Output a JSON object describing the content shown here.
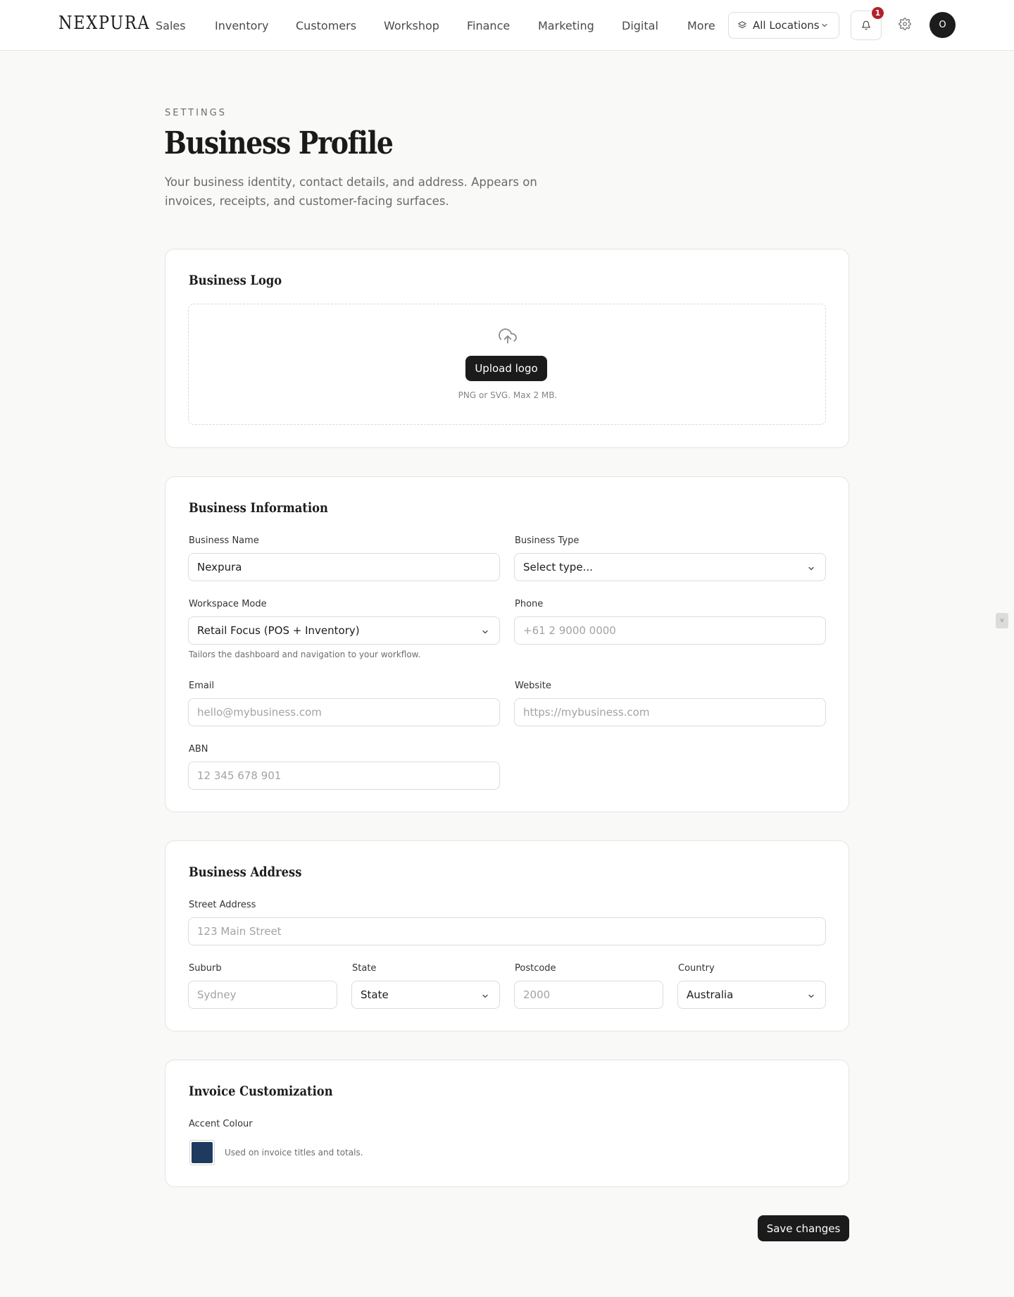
{
  "app": {
    "brand": "NEXPURA"
  },
  "nav": {
    "items": [
      "Sales",
      "Inventory",
      "Customers",
      "Workshop",
      "Finance",
      "Marketing",
      "Digital",
      "More"
    ],
    "location_selector": "All Locations",
    "notifications_count": "1",
    "avatar_initial": "O"
  },
  "header": {
    "eyebrow": "SETTINGS",
    "title": "Business Profile",
    "description": "Your business identity, contact details, and address. Appears on invoices, receipts, and customer-facing surfaces."
  },
  "logo_card": {
    "title": "Business Logo",
    "upload_label": "Upload logo",
    "hint": "PNG or SVG. Max 2 MB."
  },
  "info_card": {
    "title": "Business Information",
    "business_name": {
      "label": "Business Name",
      "value": "Nexpura"
    },
    "business_type": {
      "label": "Business Type",
      "value": "Select type..."
    },
    "workspace_mode": {
      "label": "Workspace Mode",
      "value": "Retail Focus (POS + Inventory)",
      "helper": "Tailors the dashboard and navigation to your workflow."
    },
    "phone": {
      "label": "Phone",
      "placeholder": "+61 2 9000 0000"
    },
    "email": {
      "label": "Email",
      "placeholder": "hello@mybusiness.com"
    },
    "website": {
      "label": "Website",
      "placeholder": "https://mybusiness.com"
    },
    "abn": {
      "label": "ABN",
      "placeholder": "12 345 678 901"
    }
  },
  "address_card": {
    "title": "Business Address",
    "street": {
      "label": "Street Address",
      "placeholder": "123 Main Street"
    },
    "suburb": {
      "label": "Suburb",
      "placeholder": "Sydney"
    },
    "state": {
      "label": "State",
      "value": "State"
    },
    "postcode": {
      "label": "Postcode",
      "placeholder": "2000"
    },
    "country": {
      "label": "Country",
      "value": "Australia"
    }
  },
  "invoice_card": {
    "title": "Invoice Customization",
    "accent": {
      "label": "Accent Colour",
      "helper": "Used on invoice titles and totals.",
      "color": "#1e3a5f"
    }
  },
  "actions": {
    "save_label": "Save changes"
  },
  "misc": {
    "side_chip": "v"
  }
}
